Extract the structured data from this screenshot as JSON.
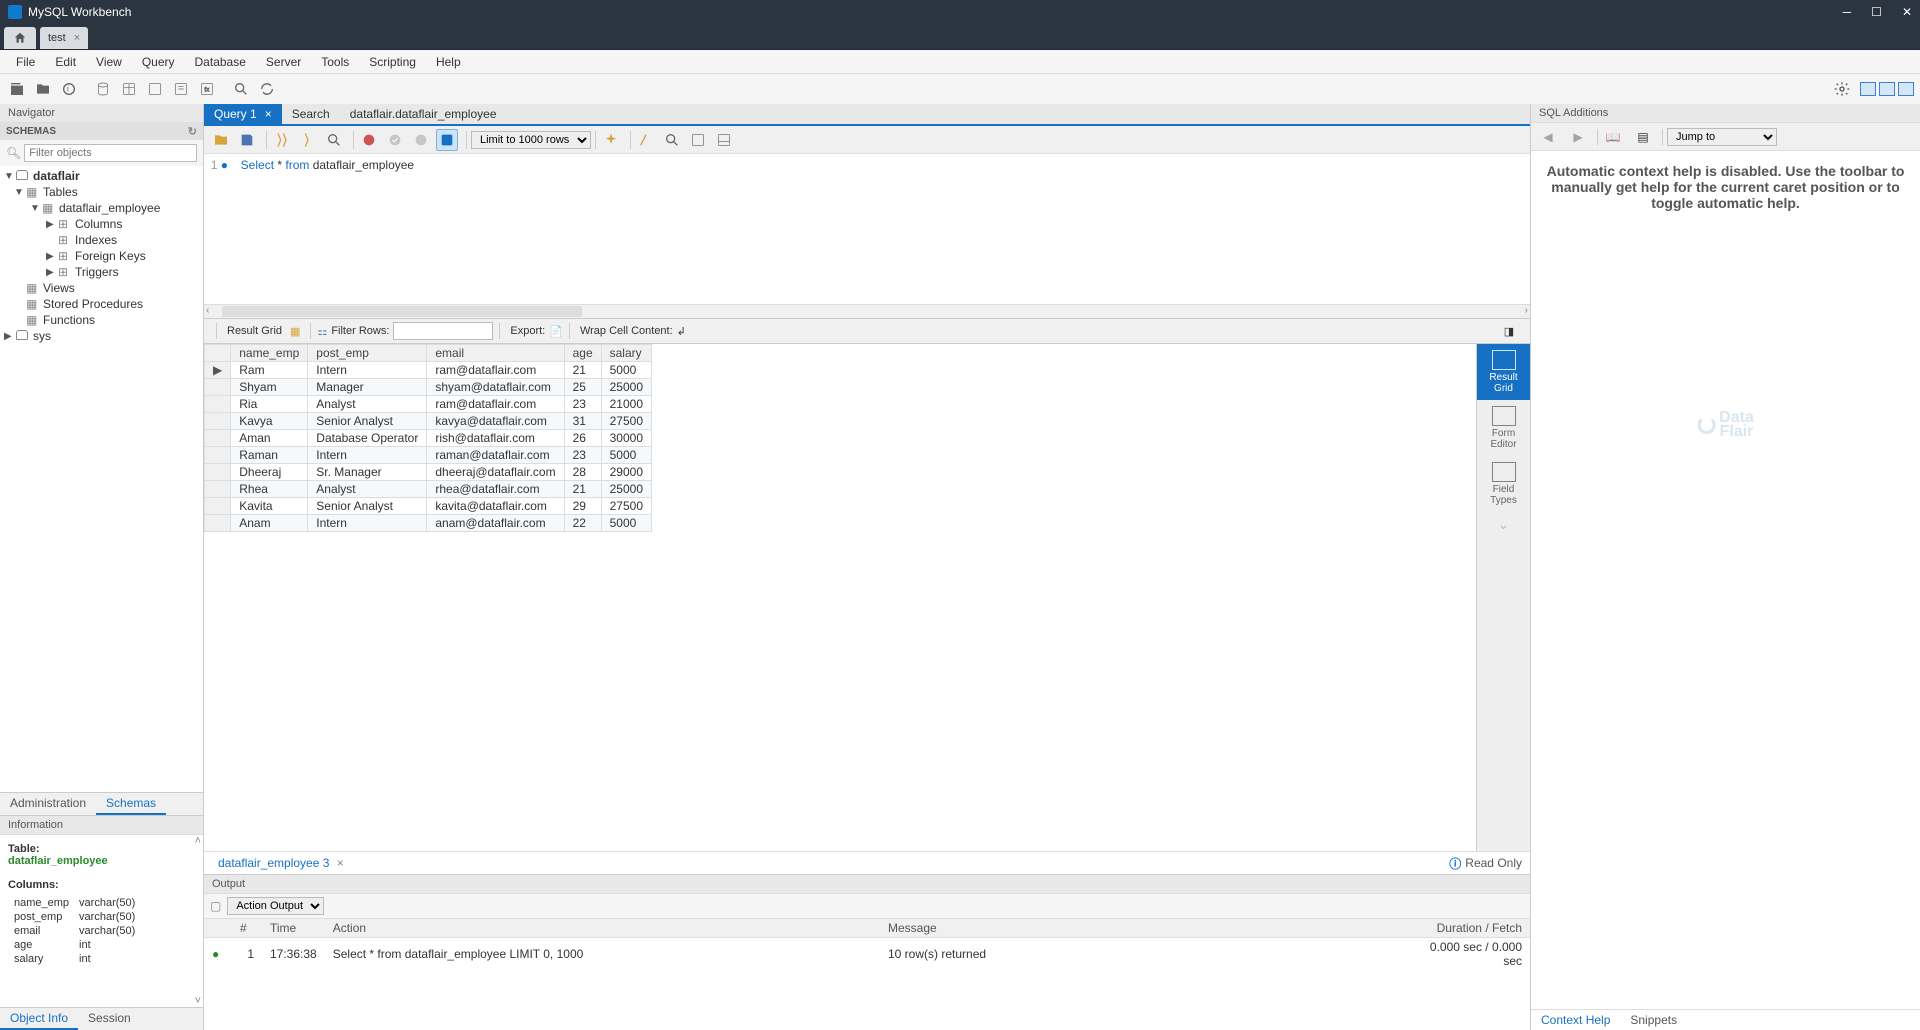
{
  "app": {
    "title": "MySQL Workbench"
  },
  "conn_tab": {
    "name": "test"
  },
  "menu": [
    "File",
    "Edit",
    "View",
    "Query",
    "Database",
    "Server",
    "Tools",
    "Scripting",
    "Help"
  ],
  "navigator": {
    "title": "Navigator",
    "schemas_label": "SCHEMAS",
    "filter_placeholder": "Filter objects",
    "tree_db": "dataflair",
    "tree_tables": "Tables",
    "tree_table": "dataflair_employee",
    "tree_columns": "Columns",
    "tree_indexes": "Indexes",
    "tree_fk": "Foreign Keys",
    "tree_triggers": "Triggers",
    "tree_views": "Views",
    "tree_sp": "Stored Procedures",
    "tree_fn": "Functions",
    "tree_sys": "sys",
    "nav_tabs": {
      "admin": "Administration",
      "schemas": "Schemas"
    }
  },
  "info": {
    "title": "Information",
    "table_label": "Table:",
    "table_name": "dataflair_employee",
    "columns_label": "Columns:",
    "columns": [
      {
        "name": "name_emp",
        "type": "varchar(50)"
      },
      {
        "name": "post_emp",
        "type": "varchar(50)"
      },
      {
        "name": "email",
        "type": "varchar(50)"
      },
      {
        "name": "age",
        "type": "int"
      },
      {
        "name": "salary",
        "type": "int"
      }
    ],
    "tabs": {
      "objinfo": "Object Info",
      "session": "Session"
    }
  },
  "editor": {
    "tab1": "Query 1",
    "tab2": "Search",
    "tab3": "dataflair.dataflair_employee",
    "limit": "Limit to 1000 rows",
    "sql_kw1": "Select",
    "sql_star": " * ",
    "sql_kw2": "from",
    "sql_ident": " dataflair_employee"
  },
  "result": {
    "grid_label": "Result Grid",
    "filter_label": "Filter Rows:",
    "export_label": "Export:",
    "wrap_label": "Wrap Cell Content:",
    "columns": [
      "name_emp",
      "post_emp",
      "email",
      "age",
      "salary"
    ],
    "rows": [
      [
        "Ram",
        "Intern",
        "ram@dataflair.com",
        "21",
        "5000"
      ],
      [
        "Shyam",
        "Manager",
        "shyam@dataflair.com",
        "25",
        "25000"
      ],
      [
        "Ria",
        "Analyst",
        "ram@dataflair.com",
        "23",
        "21000"
      ],
      [
        "Kavya",
        "Senior Analyst",
        "kavya@dataflair.com",
        "31",
        "27500"
      ],
      [
        "Aman",
        "Database Operator",
        "rish@dataflair.com",
        "26",
        "30000"
      ],
      [
        "Raman",
        "Intern",
        "raman@dataflair.com",
        "23",
        "5000"
      ],
      [
        "Dheeraj",
        "Sr. Manager",
        "dheeraj@dataflair.com",
        "28",
        "29000"
      ],
      [
        "Rhea",
        "Analyst",
        "rhea@dataflair.com",
        "21",
        "25000"
      ],
      [
        "Kavita",
        "Senior Analyst",
        "kavita@dataflair.com",
        "29",
        "27500"
      ],
      [
        "Anam",
        "Intern",
        "anam@dataflair.com",
        "22",
        "5000"
      ]
    ],
    "tab": "dataflair_employee 3",
    "readonly": "Read Only",
    "side": {
      "grid": "Result\nGrid",
      "form": "Form\nEditor",
      "types": "Field\nTypes"
    }
  },
  "output": {
    "title": "Output",
    "mode": "Action Output",
    "headers": {
      "num": "#",
      "time": "Time",
      "action": "Action",
      "message": "Message",
      "duration": "Duration / Fetch"
    },
    "row": {
      "num": "1",
      "time": "17:36:38",
      "action": "Select * from dataflair_employee LIMIT 0, 1000",
      "message": "10 row(s) returned",
      "duration": "0.000 sec / 0.000 sec"
    }
  },
  "additions": {
    "title": "SQL Additions",
    "jump": "Jump to",
    "body": "Automatic context help is disabled. Use the toolbar to manually get help for the current caret position or to toggle automatic help.",
    "tabs": {
      "context": "Context Help",
      "snippets": "Snippets"
    },
    "watermark": "Data\nFlair"
  }
}
